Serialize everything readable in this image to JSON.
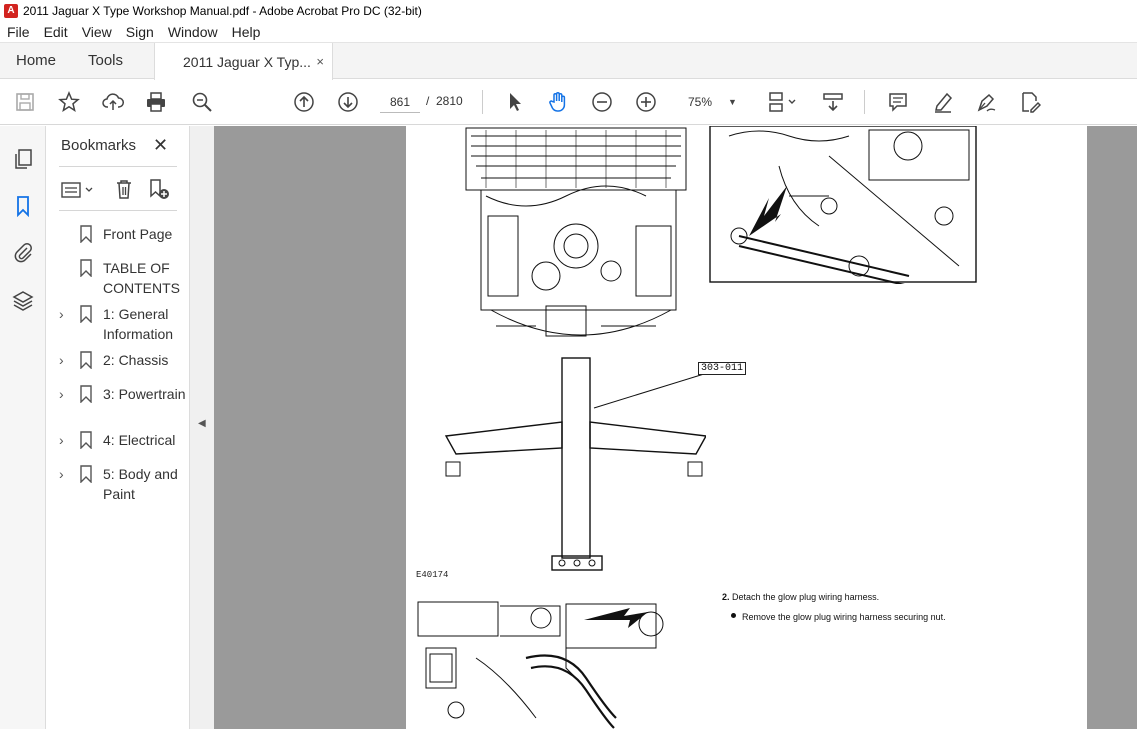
{
  "window": {
    "title": "2011 Jaguar X Type Workshop Manual.pdf - Adobe Acrobat Pro DC (32-bit)"
  },
  "menu": [
    "File",
    "Edit",
    "View",
    "Sign",
    "Window",
    "Help"
  ],
  "tabs": {
    "home": "Home",
    "tools": "Tools",
    "document": "2011 Jaguar X Typ...",
    "close": "×"
  },
  "toolbar": {
    "page_current": "861",
    "page_separator": "/",
    "page_total": "2810",
    "zoom": "75%"
  },
  "bookmarks": {
    "title": "Bookmarks",
    "items": [
      {
        "label": "Front Page"
      },
      {
        "label": "TABLE OF CONTENTS"
      },
      {
        "label": "1: General Information"
      },
      {
        "label": "2: Chassis"
      },
      {
        "label": "3: Powertrain"
      },
      {
        "label": "4: Electrical"
      },
      {
        "label": "5: Body and Paint"
      }
    ]
  },
  "document": {
    "callout": "303-011",
    "figure_id": "E40174",
    "step_number": "2.",
    "step_text": "Detach the glow plug wiring harness.",
    "bullet_text": "Remove the glow plug wiring harness securing nut."
  }
}
